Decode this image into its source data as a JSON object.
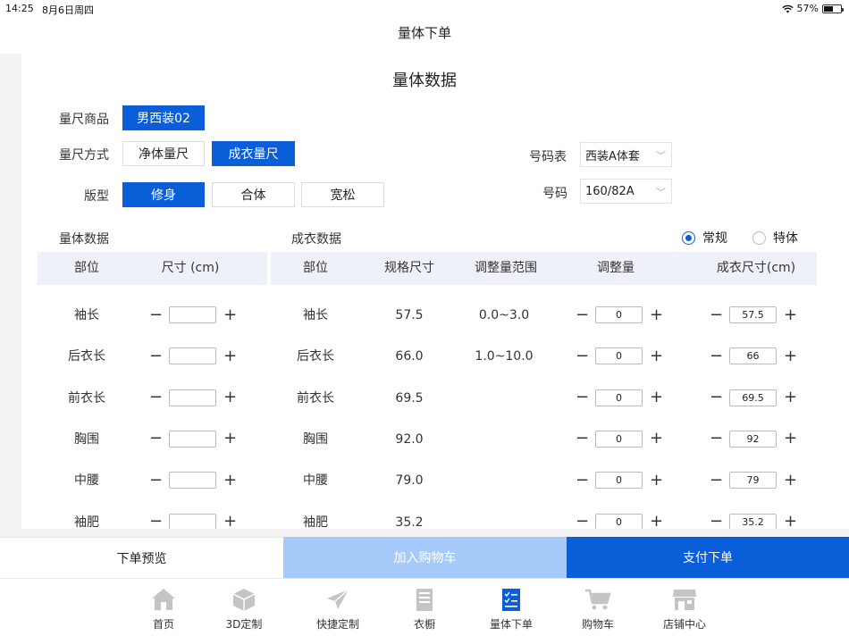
{
  "status": {
    "time": "14:25",
    "date": "8月6日周四",
    "battery": "57%",
    "battery_level": 0.57
  },
  "nav": {
    "title": "量体下单"
  },
  "card": {
    "title": "量体数据",
    "product_label": "量尺商品",
    "product_value": "男西装02",
    "method_label": "量尺方式",
    "methods": [
      "净体量尺",
      "成衣量尺"
    ],
    "method_selected": "成衣量尺",
    "fit_label": "版型",
    "fits": [
      "修身",
      "合体",
      "宽松"
    ],
    "fit_selected": "修身",
    "size_table_label": "号码表",
    "size_table_value": "西装A体套",
    "size_label": "号码",
    "size_value": "160/82A"
  },
  "body_section": {
    "title": "量体数据",
    "headers": [
      "部位",
      "尺寸 (cm)"
    ]
  },
  "garment_section": {
    "title": "成衣数据",
    "radio_normal": "常规",
    "radio_special": "特体",
    "radio_selected": "常规",
    "headers": [
      "部位",
      "规格尺寸",
      "调整量范围",
      "调整量",
      "成衣尺寸(cm)"
    ]
  },
  "rows": [
    {
      "part": "袖长",
      "body_size": "",
      "spec": "57.5",
      "range": "0.0~3.0",
      "adjust": "0",
      "final": "57.5"
    },
    {
      "part": "后衣长",
      "body_size": "",
      "spec": "66.0",
      "range": "1.0~10.0",
      "adjust": "0",
      "final": "66"
    },
    {
      "part": "前衣长",
      "body_size": "",
      "spec": "69.5",
      "range": "",
      "adjust": "0",
      "final": "69.5"
    },
    {
      "part": "胸围",
      "body_size": "",
      "spec": "92.0",
      "range": "",
      "adjust": "0",
      "final": "92"
    },
    {
      "part": "中腰",
      "body_size": "",
      "spec": "79.0",
      "range": "",
      "adjust": "0",
      "final": "79"
    },
    {
      "part": "袖肥",
      "body_size": "",
      "spec": "35.2",
      "range": "",
      "adjust": "0",
      "final": "35.2"
    }
  ],
  "stepper": {
    "minus": "−",
    "plus": "+"
  },
  "actions": {
    "preview": "下单预览",
    "add_cart": "加入购物车",
    "pay": "支付下单"
  },
  "tabs": [
    {
      "label": "首页",
      "icon": "home-icon"
    },
    {
      "label": "3D定制",
      "icon": "cube-icon"
    },
    {
      "label": "快捷定制",
      "icon": "paper-plane-icon"
    },
    {
      "label": "衣橱",
      "icon": "wardrobe-icon"
    },
    {
      "label": "量体下单",
      "icon": "checklist-icon",
      "active": true
    },
    {
      "label": "购物车",
      "icon": "cart-icon"
    },
    {
      "label": "店铺中心",
      "icon": "store-icon"
    }
  ],
  "colors": {
    "primary": "#0a5fd8",
    "primary_light": "#a6cbfb",
    "table_header_bg": "#eef2f8",
    "tab_icon_gray": "#c4c4c4"
  }
}
